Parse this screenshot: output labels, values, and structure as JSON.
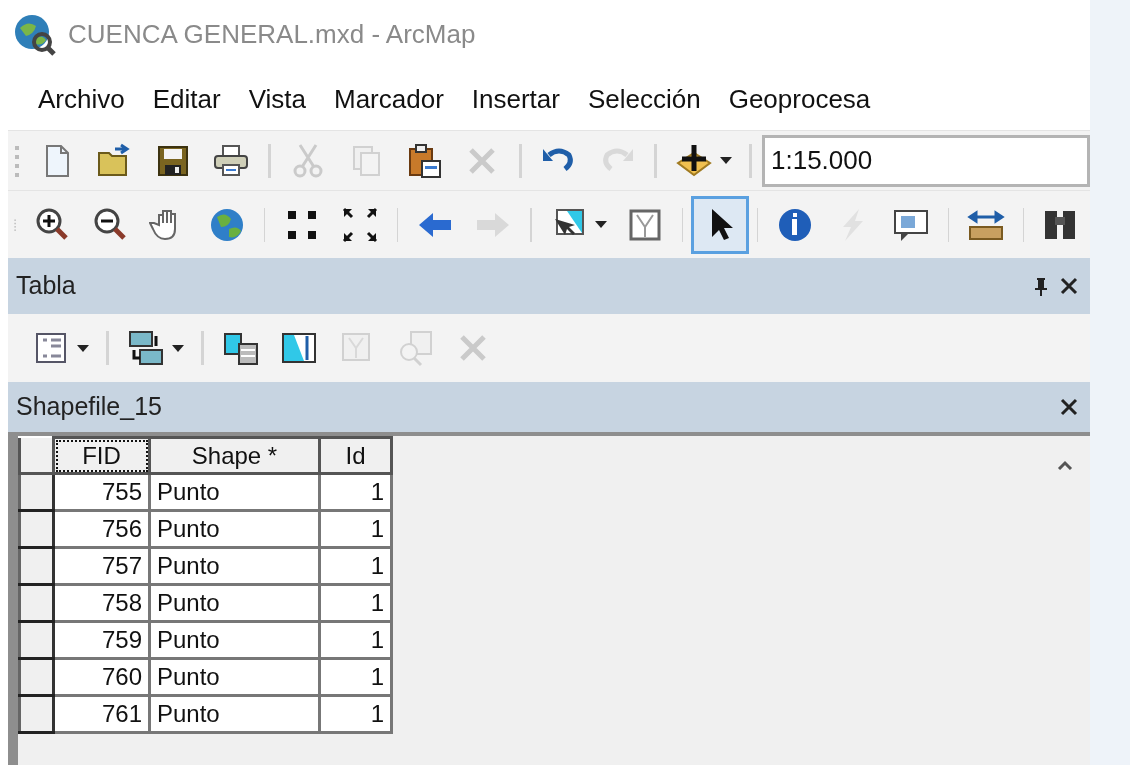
{
  "window": {
    "title": "CUENCA GENERAL.mxd - ArcMap"
  },
  "menu": [
    "Archivo",
    "Editar",
    "Vista",
    "Marcador",
    "Insertar",
    "Selección",
    "Geoprocesa"
  ],
  "toolbars": [
    {
      "items": [
        {
          "kind": "button",
          "disabled": false
        },
        {
          "kind": "button",
          "disabled": false
        },
        {
          "kind": "button",
          "disabled": false
        },
        {
          "kind": "button",
          "disabled": false
        },
        {
          "kind": "separator"
        },
        {
          "kind": "button",
          "disabled": true
        },
        {
          "kind": "button",
          "disabled": true
        },
        {
          "kind": "button",
          "disabled": false
        },
        {
          "kind": "button",
          "disabled": true
        },
        {
          "kind": "separator"
        },
        {
          "kind": "button",
          "disabled": false
        },
        {
          "kind": "button",
          "disabled": true
        },
        {
          "kind": "separator"
        },
        {
          "kind": "button",
          "disabled": false,
          "dropdown": true
        },
        {
          "kind": "separator"
        }
      ],
      "scale": "1:15.000"
    },
    {
      "items": [
        {
          "kind": "button",
          "disabled": false
        },
        {
          "kind": "button",
          "disabled": false
        },
        {
          "kind": "button",
          "disabled": false
        },
        {
          "kind": "button",
          "disabled": false
        },
        {
          "kind": "separator"
        },
        {
          "kind": "button",
          "disabled": false
        },
        {
          "kind": "button",
          "disabled": false
        },
        {
          "kind": "separator"
        },
        {
          "kind": "button",
          "disabled": false
        },
        {
          "kind": "button",
          "disabled": true
        },
        {
          "kind": "separator"
        },
        {
          "kind": "button",
          "disabled": false,
          "dropdown": true
        },
        {
          "kind": "button",
          "disabled": false
        },
        {
          "kind": "separator"
        },
        {
          "kind": "button",
          "disabled": false,
          "selected": true
        },
        {
          "kind": "separator"
        },
        {
          "kind": "button",
          "disabled": false
        },
        {
          "kind": "button",
          "disabled": true
        },
        {
          "kind": "button",
          "disabled": false
        },
        {
          "kind": "separator"
        },
        {
          "kind": "button",
          "disabled": false
        },
        {
          "kind": "separator"
        },
        {
          "kind": "button",
          "disabled": false
        }
      ]
    }
  ],
  "table_window": {
    "title": "Tabla",
    "toolbar": [
      {
        "kind": "button",
        "disabled": false,
        "dropdown": true
      },
      {
        "kind": "separator"
      },
      {
        "kind": "button",
        "disabled": false,
        "dropdown": true
      },
      {
        "kind": "separator"
      },
      {
        "kind": "button",
        "disabled": false
      },
      {
        "kind": "button",
        "disabled": false
      },
      {
        "kind": "button",
        "disabled": true
      },
      {
        "kind": "button",
        "disabled": true
      },
      {
        "kind": "button",
        "disabled": true
      }
    ],
    "tab_title": "Shapefile_15",
    "table": {
      "columns": [
        "FID",
        "Shape *",
        "Id"
      ],
      "rows": [
        {
          "fid": "755",
          "shape": "Punto",
          "id": "1"
        },
        {
          "fid": "756",
          "shape": "Punto",
          "id": "1"
        },
        {
          "fid": "757",
          "shape": "Punto",
          "id": "1"
        },
        {
          "fid": "758",
          "shape": "Punto",
          "id": "1"
        },
        {
          "fid": "759",
          "shape": "Punto",
          "id": "1"
        },
        {
          "fid": "760",
          "shape": "Punto",
          "id": "1"
        },
        {
          "fid": "761",
          "shape": "Punto",
          "id": "1"
        }
      ]
    }
  }
}
